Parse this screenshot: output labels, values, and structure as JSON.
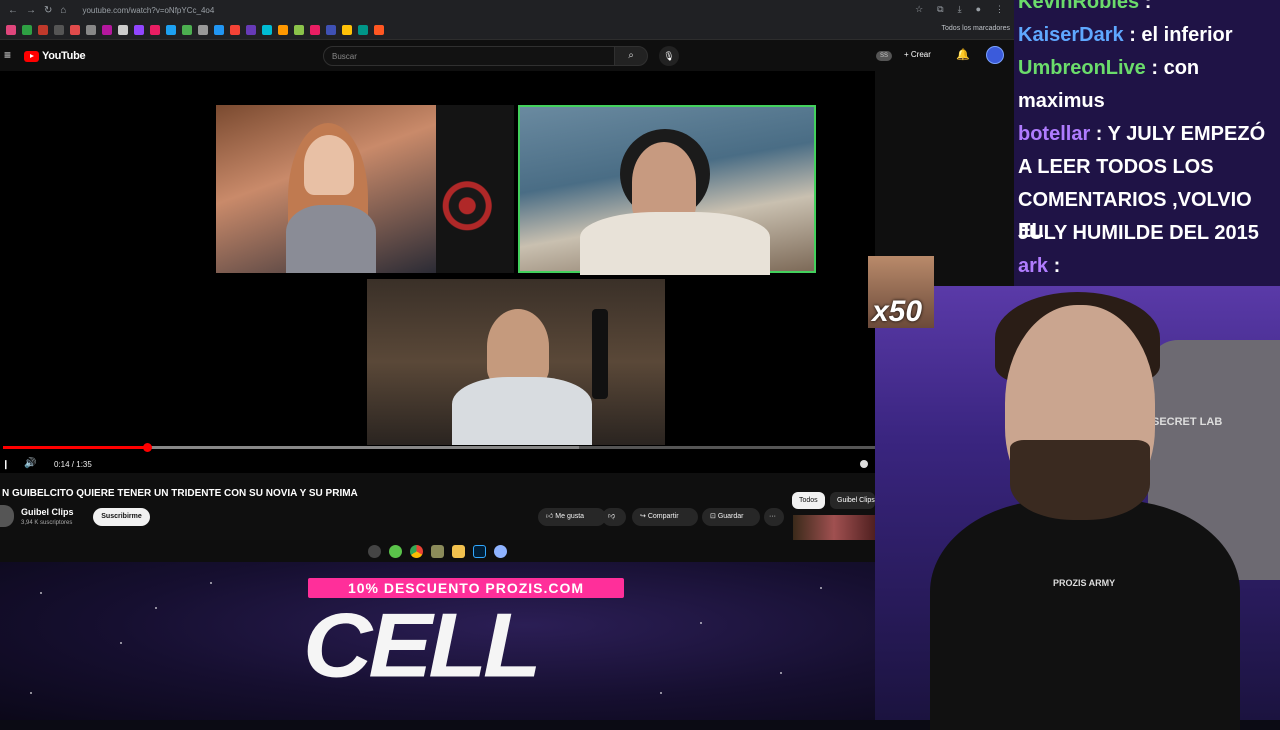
{
  "browser": {
    "url": "youtube.com/watch?v=oNfpYCc_4o4",
    "bookmarks_folder": "Todos los marcadores"
  },
  "youtube": {
    "logo_text": "YouTube",
    "search_placeholder": "Buscar",
    "create_label": "Crear",
    "player": {
      "timecode": "0:14 / 1:35",
      "progress": 0.165,
      "buffered": 0.66
    },
    "video": {
      "title": "N GUIBELCITO QUIERE TENER UN TRIDENTE CON SU NOVIA Y SU PRIMA",
      "channel": "Guibel Clips",
      "subscribers": "3,94 K suscriptores",
      "subscribe_label": "Suscribirme",
      "like_label": "Me gusta",
      "share_label": "Compartir",
      "save_label": "Guardar"
    },
    "chips": [
      "Todos",
      "Guibel Clips"
    ]
  },
  "ad": {
    "banner": "10% DESCUENTO PROZIS.COM",
    "headline": "CELL"
  },
  "chat": [
    {
      "user": "KevinRobles",
      "text": ":",
      "color": "#6bdc6b"
    },
    {
      "user": "KaiserDark",
      "text": ": el inferior",
      "color": "#5fa8ff"
    },
    {
      "user": "UmbreonLive",
      "text": ": con",
      "color": "#6bdc6b"
    },
    {
      "user": "",
      "text": "maximus",
      "color": "#ffffff"
    },
    {
      "user": "botellar",
      "text": ": Y JULY EMPEZÓ",
      "color": "#b07cff"
    },
    {
      "user": "",
      "text": "A LEER TODOS LOS",
      "color": "#ffffff"
    },
    {
      "user": "",
      "text": "COMENTARIOS ,VOLVIO EL",
      "color": "#ffffff"
    },
    {
      "user": "",
      "text": "JULY HUMILDE DEL 2015",
      "color": "#ffffff"
    },
    {
      "user": "ark",
      "text": ":",
      "color": "#b07cff"
    }
  ],
  "overlay": {
    "emote_multiplier": "x50",
    "chair_brand": "SECRET LAB",
    "shirt_text": "PROZIS ARMY"
  },
  "colors": {
    "youtube_red": "#ff0000",
    "speaker_highlight": "#43d15d",
    "ad_pink": "#ff2f9a"
  }
}
